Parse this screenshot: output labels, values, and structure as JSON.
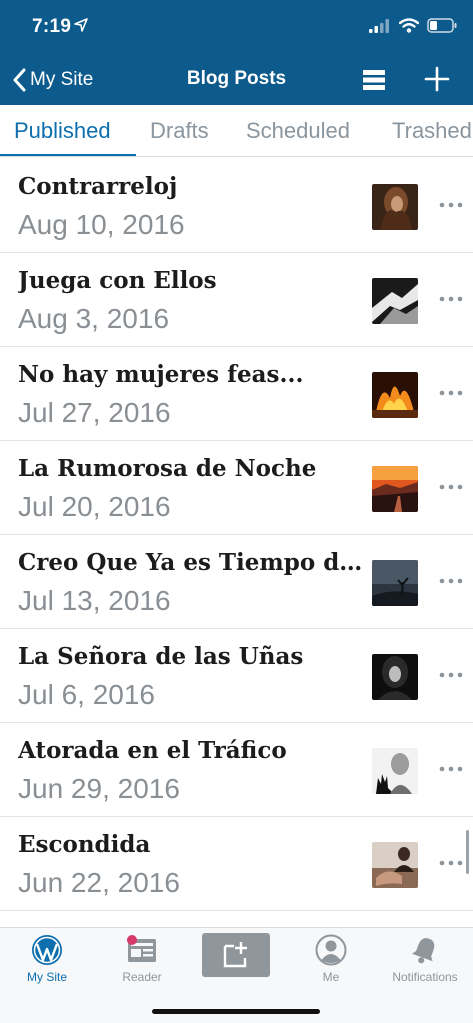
{
  "status_bar": {
    "time": "7:19",
    "location_icon": "location-arrow-icon",
    "signal_icon": "cellular-signal-icon",
    "wifi_icon": "wifi-icon",
    "battery_icon": "battery-icon"
  },
  "nav": {
    "back_label": "My Site",
    "title": "Blog Posts",
    "list_icon": "list-view-icon",
    "add_icon": "plus-icon"
  },
  "tabs": {
    "items": [
      {
        "label": "Published",
        "active": true
      },
      {
        "label": "Drafts",
        "active": false
      },
      {
        "label": "Scheduled",
        "active": false
      },
      {
        "label": "Trashed",
        "active": false
      }
    ]
  },
  "posts": [
    {
      "title": "Contrarreloj",
      "date": "Aug 10, 2016",
      "thumb": "portrait-photo"
    },
    {
      "title": "Juega con Ellos",
      "date": "Aug 3, 2016",
      "thumb": "hands-photo"
    },
    {
      "title": "No hay mujeres feas...",
      "date": "Jul 27, 2016",
      "thumb": "fire-photo"
    },
    {
      "title": "La Rumorosa de Noche",
      "date": "Jul 20, 2016",
      "thumb": "sunset-road-photo"
    },
    {
      "title": "Creo Que Ya es Tiempo de Crecer",
      "date": "Jul 13, 2016",
      "thumb": "tree-silhouette-photo"
    },
    {
      "title": "La Señora de las Uñas",
      "date": "Jul 6, 2016",
      "thumb": "woman-dark-photo"
    },
    {
      "title": "Atorada en el Tráfico",
      "date": "Jun 29, 2016",
      "thumb": "hand-silhouette-photo"
    },
    {
      "title": "Escondida",
      "date": "Jun 22, 2016",
      "thumb": "couple-photo"
    }
  ],
  "more_icon": "more-horizontal-icon",
  "tab_bar": {
    "items": [
      {
        "label": "My Site",
        "icon": "wordpress-icon",
        "active": true
      },
      {
        "label": "Reader",
        "icon": "reader-icon",
        "active": false
      },
      {
        "label": "",
        "icon": "new-post-icon",
        "active": false
      },
      {
        "label": "Me",
        "icon": "person-icon",
        "active": false
      },
      {
        "label": "Notifications",
        "icon": "bell-icon",
        "active": false
      }
    ]
  },
  "colors": {
    "header_blue": "#0d5b8c",
    "accent_blue": "#0d6fae",
    "notification_dot": "#d63a6c"
  }
}
